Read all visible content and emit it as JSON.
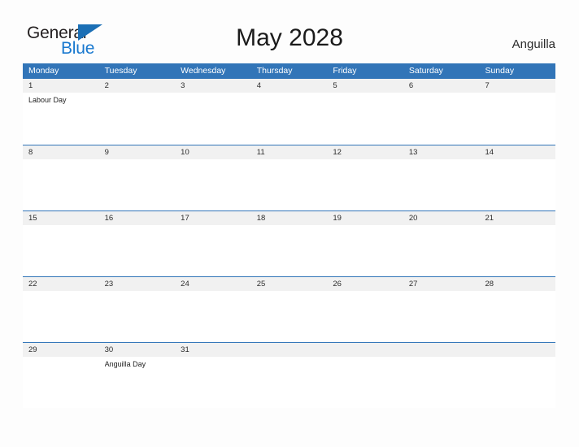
{
  "brand": {
    "name_part1": "General",
    "name_part2": "Blue",
    "flag_icon": "blue-triangle-flag-icon",
    "color_dark": "#231f20",
    "color_blue": "#1878cf"
  },
  "header": {
    "title": "May 2028",
    "locale": "Anguilla"
  },
  "colors": {
    "header_blue": "#3275b8",
    "row_divider_blue": "#3275b8",
    "daynum_strip_gray": "#f1f1f1",
    "page_background": "#fdfdfd",
    "text": "#222222"
  },
  "calendar": {
    "weekdays": [
      "Monday",
      "Tuesday",
      "Wednesday",
      "Thursday",
      "Friday",
      "Saturday",
      "Sunday"
    ],
    "weeks": [
      [
        {
          "day": "1",
          "events": [
            "Labour Day"
          ]
        },
        {
          "day": "2",
          "events": []
        },
        {
          "day": "3",
          "events": []
        },
        {
          "day": "4",
          "events": []
        },
        {
          "day": "5",
          "events": []
        },
        {
          "day": "6",
          "events": []
        },
        {
          "day": "7",
          "events": []
        }
      ],
      [
        {
          "day": "8",
          "events": []
        },
        {
          "day": "9",
          "events": []
        },
        {
          "day": "10",
          "events": []
        },
        {
          "day": "11",
          "events": []
        },
        {
          "day": "12",
          "events": []
        },
        {
          "day": "13",
          "events": []
        },
        {
          "day": "14",
          "events": []
        }
      ],
      [
        {
          "day": "15",
          "events": []
        },
        {
          "day": "16",
          "events": []
        },
        {
          "day": "17",
          "events": []
        },
        {
          "day": "18",
          "events": []
        },
        {
          "day": "19",
          "events": []
        },
        {
          "day": "20",
          "events": []
        },
        {
          "day": "21",
          "events": []
        }
      ],
      [
        {
          "day": "22",
          "events": []
        },
        {
          "day": "23",
          "events": []
        },
        {
          "day": "24",
          "events": []
        },
        {
          "day": "25",
          "events": []
        },
        {
          "day": "26",
          "events": []
        },
        {
          "day": "27",
          "events": []
        },
        {
          "day": "28",
          "events": []
        }
      ],
      [
        {
          "day": "29",
          "events": []
        },
        {
          "day": "30",
          "events": [
            "Anguilla Day"
          ]
        },
        {
          "day": "31",
          "events": []
        },
        {
          "day": "",
          "events": []
        },
        {
          "day": "",
          "events": []
        },
        {
          "day": "",
          "events": []
        },
        {
          "day": "",
          "events": []
        }
      ]
    ]
  }
}
